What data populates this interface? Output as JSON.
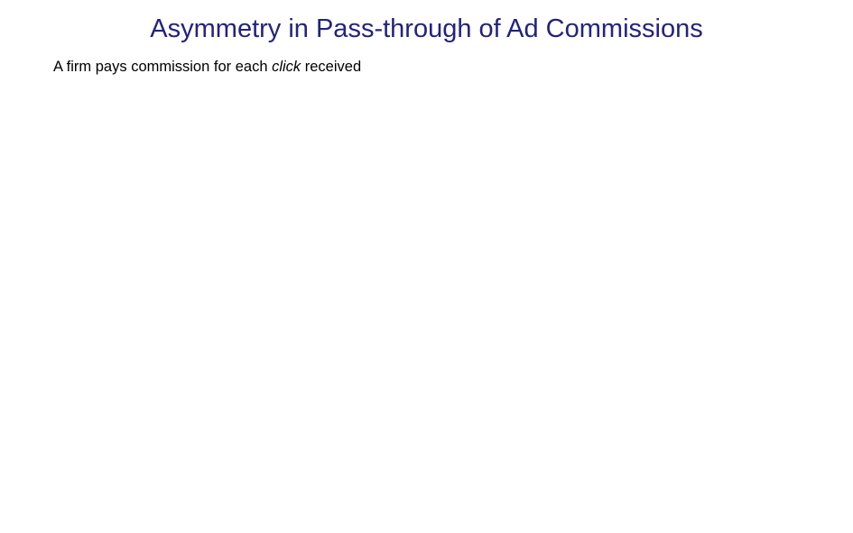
{
  "slide": {
    "title": "Asymmetry in Pass-through of Ad Commissions",
    "body_line": {
      "before": "A firm pays commission for each ",
      "emphasis": "click",
      "after": " received"
    }
  },
  "colors": {
    "title": "#23237f",
    "text": "#000000",
    "background": "#ffffff"
  }
}
